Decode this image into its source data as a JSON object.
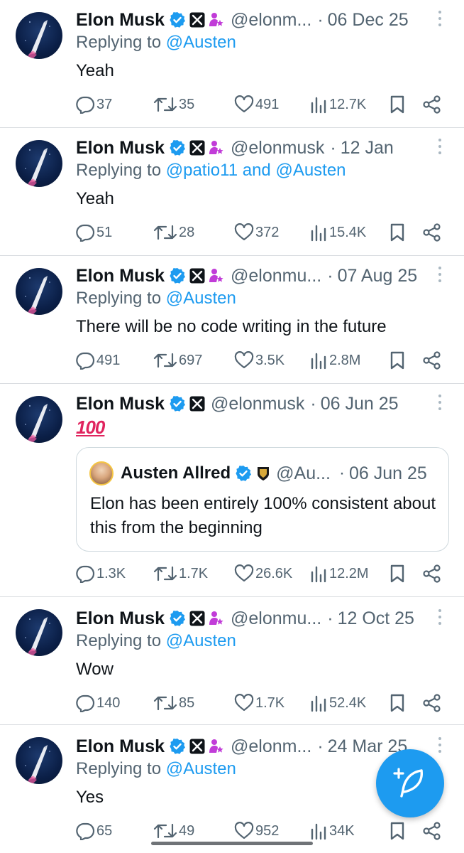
{
  "tweets": [
    {
      "name": "Elon Musk",
      "handle": "@elonm...",
      "date": "06 Dec 25",
      "reply_prefix": "Replying to ",
      "reply_to": "@Austen",
      "text": "Yeah",
      "replies": "37",
      "reposts": "35",
      "likes": "491",
      "views": "12.7K",
      "has_person_badge": true
    },
    {
      "name": "Elon Musk",
      "handle": "@elonmusk",
      "date": "12 Jan",
      "reply_prefix": "Replying to ",
      "reply_to": "@patio11 and @Austen",
      "text": "Yeah",
      "replies": "51",
      "reposts": "28",
      "likes": "372",
      "views": "15.4K",
      "has_person_badge": true
    },
    {
      "name": "Elon Musk",
      "handle": "@elonmu...",
      "date": "07 Aug 25",
      "reply_prefix": "Replying to ",
      "reply_to": "@Austen",
      "text": "There will be no code writing in the future",
      "replies": "491",
      "reposts": "697",
      "likes": "3.5K",
      "views": "2.8M",
      "has_person_badge": true
    },
    {
      "name": "Elon Musk",
      "handle": "@elonmusk",
      "date": "06 Jun 25",
      "text": "100",
      "replies": "1.3K",
      "reposts": "1.7K",
      "likes": "26.6K",
      "views": "12.2M",
      "has_person_badge": false,
      "quote": {
        "name": "Austen Allred",
        "handle": "@Au...",
        "date": "06 Jun 25",
        "text": "Elon has been entirely 100% consistent about this from the beginning"
      }
    },
    {
      "name": "Elon Musk",
      "handle": "@elonmu...",
      "date": "12 Oct 25",
      "reply_prefix": "Replying to ",
      "reply_to": "@Austen",
      "text": "Wow",
      "replies": "140",
      "reposts": "85",
      "likes": "1.7K",
      "views": "52.4K",
      "has_person_badge": true
    },
    {
      "name": "Elon Musk",
      "handle": "@elonm...",
      "date": "24 Mar 25",
      "reply_prefix": "Replying to ",
      "reply_to": "@Austen",
      "text": "Yes",
      "replies": "65",
      "reposts": "49",
      "likes": "952",
      "views": "34K",
      "has_person_badge": true
    }
  ],
  "separator": "·",
  "icons": {
    "reply": "reply-icon",
    "repost": "repost-icon",
    "like": "heart-icon",
    "views": "views-chart-icon",
    "bookmark": "bookmark-icon",
    "share": "share-icon",
    "verified": "verified-badge-icon",
    "affiliate": "x-affiliate-badge-icon",
    "compose": "compose-post-icon"
  },
  "colors": {
    "accent": "#1d9bf0",
    "secondary_text": "#536471",
    "divider": "#dadde1",
    "person_badge": "#c13cd8"
  }
}
